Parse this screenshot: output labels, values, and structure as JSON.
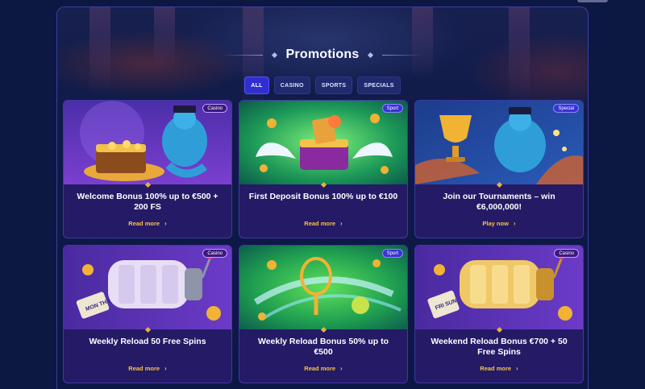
{
  "page": {
    "title": "Promotions"
  },
  "filters": [
    {
      "label": "ALL",
      "active": true
    },
    {
      "label": "CASINO",
      "active": false
    },
    {
      "label": "SPORTS",
      "active": false
    },
    {
      "label": "SPECIALS",
      "active": false
    }
  ],
  "cards": [
    {
      "badge": "Casino",
      "title": "Welcome Bonus 100% up to €500 + 200 FS",
      "link": "Read more",
      "art": "genie-treasure-chest"
    },
    {
      "badge": "Sport",
      "title": "First Deposit Bonus 100% up to €100",
      "link": "Read more",
      "art": "winged-sports-chest"
    },
    {
      "badge": "Special",
      "title": "Join our Tournaments – win €6,000,000!",
      "link": "Play now",
      "art": "genie-trophy"
    },
    {
      "badge": "Casino",
      "title": "Weekly Reload 50 Free Spins",
      "link": "Read more",
      "art": "slot-reel-mon-thu"
    },
    {
      "badge": "Sport",
      "title": "Weekly Reload Bonus 50% up to €500",
      "link": "Read more",
      "art": "tennis-racket-swirl"
    },
    {
      "badge": "Casino",
      "title": "Weekend Reload Bonus €700 + 50 Free Spins",
      "link": "Read more",
      "art": "slot-reel-fri-sun"
    }
  ],
  "art_text": {
    "mon_thu": "MON THU",
    "fri_sun": "FRI SUN"
  },
  "colors": {
    "accent": "#2f2ed0",
    "link": "#f5c447",
    "card_bg": "#241a66"
  }
}
